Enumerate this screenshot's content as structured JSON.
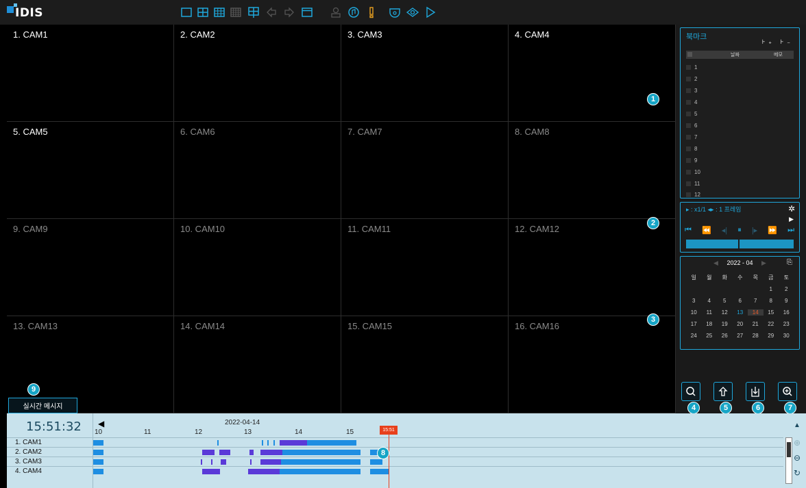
{
  "app": {
    "logo_text": "IDIS"
  },
  "toolbar": {
    "icons": [
      "layout-1-icon",
      "layout-4-icon",
      "layout-9-icon",
      "layout-16-icon",
      "custom-layout-icon",
      "prev-group-icon",
      "next-group-icon",
      "screen-mode-icon",
      "user-icon",
      "audio-icon",
      "alarm-icon",
      "camera-icon",
      "view-icon",
      "play-icon"
    ]
  },
  "cameras": [
    {
      "label": "1. CAM1",
      "active": true
    },
    {
      "label": "2. CAM2",
      "active": true
    },
    {
      "label": "3. CAM3",
      "active": true
    },
    {
      "label": "4. CAM4",
      "active": true
    },
    {
      "label": "5. CAM5",
      "active": true
    },
    {
      "label": "6. CAM6",
      "active": false
    },
    {
      "label": "7. CAM7",
      "active": false
    },
    {
      "label": "8. CAM8",
      "active": false
    },
    {
      "label": "9. CAM9",
      "active": false
    },
    {
      "label": "10. CAM10",
      "active": false
    },
    {
      "label": "11. CAM11",
      "active": false
    },
    {
      "label": "12. CAM12",
      "active": false
    },
    {
      "label": "13. CAM13",
      "active": false
    },
    {
      "label": "14. CAM14",
      "active": false
    },
    {
      "label": "15. CAM15",
      "active": false
    },
    {
      "label": "16. CAM16",
      "active": false
    }
  ],
  "callouts": [
    "1",
    "2",
    "3",
    "4",
    "5",
    "6",
    "7",
    "8",
    "9"
  ],
  "live_message_button": "실시간 메시지",
  "bookmark": {
    "title": "북마크",
    "tools": "⊦₊ ⊦₋",
    "col_date": "날짜",
    "col_memo": "메모",
    "rows": [
      "1",
      "2",
      "3",
      "4",
      "5",
      "6",
      "7",
      "8",
      "9",
      "10",
      "11",
      "12"
    ]
  },
  "playback": {
    "speed_text": "▸ : x1/1  ◂▸ : 1 프레임",
    "gear": "✲",
    "side_arrow": "▶",
    "buttons": [
      "⏮",
      "⏪",
      "◂|",
      "⏸",
      "|▸",
      "⏩",
      "⏭"
    ]
  },
  "calendar": {
    "month_label": "2022 - 04",
    "prev": "◀",
    "next": "▶",
    "weekdays": [
      "일",
      "월",
      "화",
      "수",
      "목",
      "금",
      "토"
    ],
    "weeks": [
      [
        "",
        "",
        "",
        "",
        "",
        "1",
        "2"
      ],
      [
        "3",
        "4",
        "5",
        "6",
        "7",
        "8",
        "9"
      ],
      [
        "10",
        "11",
        "12",
        "13",
        "14",
        "15",
        "16"
      ],
      [
        "17",
        "18",
        "19",
        "20",
        "21",
        "22",
        "23"
      ],
      [
        "24",
        "25",
        "26",
        "27",
        "28",
        "29",
        "30"
      ]
    ],
    "available_day": "13",
    "selected_day": "14"
  },
  "controls": {
    "search": "🔍",
    "export": "⇧",
    "clip": "⬇",
    "zoom": "⊕"
  },
  "timeline": {
    "current_time": "15:51:32",
    "date_label": "2022-04-14",
    "hours": [
      "10",
      "11",
      "12",
      "13",
      "14",
      "15"
    ],
    "now_tag": "15:51",
    "rows": [
      "1. CAM1",
      "2. CAM2",
      "3. CAM3",
      "4. CAM4"
    ],
    "side_up": "▲",
    "side_plus": "⊕",
    "side_minus": "⊖",
    "side_refresh": "↻"
  }
}
